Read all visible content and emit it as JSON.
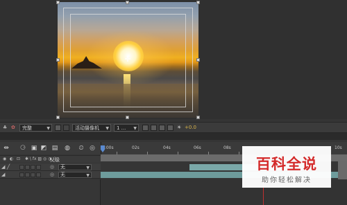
{
  "viewer": {
    "resolution_select": "完整",
    "camera_select": "活动摄像机",
    "view_count_select": "1 ...",
    "exposure_value": "+0.0"
  },
  "timeline": {
    "ruler_labels": [
      "0:00s",
      "02s",
      "04s",
      "06s",
      "08s",
      "10s"
    ],
    "parent_column_label": "父级",
    "layers": [
      {
        "parent": "无"
      },
      {
        "parent": "无"
      }
    ]
  },
  "watermark": {
    "title": "百科全说",
    "subtitle": "助你轻松解决"
  },
  "colors": {
    "panel_bg": "#353535",
    "accent_blue": "#5a8ad0",
    "track_teal": "#7aa8a8",
    "watermark_red": "#d42a2a"
  }
}
